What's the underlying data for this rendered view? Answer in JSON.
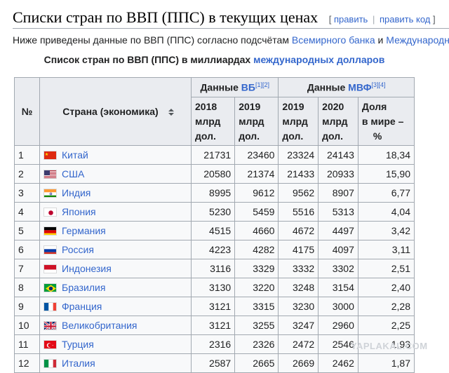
{
  "heading": {
    "title": "Списки стран по ВВП (ППС) в текущих ценах",
    "edit_bracket_open": "[",
    "edit_label": "править",
    "separator": "|",
    "edit_code_label": "править код",
    "edit_bracket_close": "]"
  },
  "intro": {
    "text_before": "Ниже приведены данные по ВВП (ППС) согласно подсчётам ",
    "link_world_bank": "Всемирного банка",
    "text_and": " и ",
    "link_imf": "Международного"
  },
  "caption": {
    "text": "Список стран по ВВП (ППС) в миллиардах ",
    "link": "международных долларов"
  },
  "table": {
    "header": {
      "number": "№",
      "country": "Страна (экономика)",
      "wb_group_prefix": "Данные ",
      "wb_group_link": "ВБ",
      "wb_refs": "[1][2]",
      "imf_group_prefix": "Данные ",
      "imf_group_link": "МВФ",
      "imf_refs": "[3][4]",
      "columns": [
        {
          "year": "2018",
          "unit1": "млрд",
          "unit2": "дол."
        },
        {
          "year": "2019",
          "unit1": "млрд",
          "unit2": "дол."
        },
        {
          "year": "2019",
          "unit1": "млрд",
          "unit2": "дол."
        },
        {
          "year": "2020",
          "unit1": "млрд",
          "unit2": "дол."
        }
      ],
      "share": {
        "line1": "Доля",
        "line2": "в мире –",
        "line3": "%"
      }
    },
    "rows": [
      {
        "rank": "1",
        "country": "Китай",
        "flag": "flag-china-icon",
        "wb2018": "21731",
        "wb2019": "23460",
        "imf2019": "23324",
        "imf2020": "24143",
        "share": "18,34"
      },
      {
        "rank": "2",
        "country": "США",
        "flag": "flag-usa-icon",
        "wb2018": "20580",
        "wb2019": "21374",
        "imf2019": "21433",
        "imf2020": "20933",
        "share": "15,90"
      },
      {
        "rank": "3",
        "country": "Индия",
        "flag": "flag-india-icon",
        "wb2018": "8995",
        "wb2019": "9612",
        "imf2019": "9562",
        "imf2020": "8907",
        "share": "6,77"
      },
      {
        "rank": "4",
        "country": "Япония",
        "flag": "flag-japan-icon",
        "wb2018": "5230",
        "wb2019": "5459",
        "imf2019": "5516",
        "imf2020": "5313",
        "share": "4,04"
      },
      {
        "rank": "5",
        "country": "Германия",
        "flag": "flag-germany-icon",
        "wb2018": "4515",
        "wb2019": "4660",
        "imf2019": "4672",
        "imf2020": "4497",
        "share": "3,42"
      },
      {
        "rank": "6",
        "country": "Россия",
        "flag": "flag-russia-icon",
        "wb2018": "4223",
        "wb2019": "4282",
        "imf2019": "4175",
        "imf2020": "4097",
        "share": "3,11"
      },
      {
        "rank": "7",
        "country": "Индонезия",
        "flag": "flag-indonesia-icon",
        "wb2018": "3116",
        "wb2019": "3329",
        "imf2019": "3332",
        "imf2020": "3302",
        "share": "2,51"
      },
      {
        "rank": "8",
        "country": "Бразилия",
        "flag": "flag-brazil-icon",
        "wb2018": "3130",
        "wb2019": "3220",
        "imf2019": "3248",
        "imf2020": "3154",
        "share": "2,40"
      },
      {
        "rank": "9",
        "country": "Франция",
        "flag": "flag-france-icon",
        "wb2018": "3121",
        "wb2019": "3315",
        "imf2019": "3230",
        "imf2020": "3000",
        "share": "2,28"
      },
      {
        "rank": "10",
        "country": "Великобритания",
        "flag": "flag-uk-icon",
        "wb2018": "3121",
        "wb2019": "3255",
        "imf2019": "3247",
        "imf2020": "2960",
        "share": "2,25"
      },
      {
        "rank": "11",
        "country": "Турция",
        "flag": "flag-turkey-icon",
        "wb2018": "2316",
        "wb2019": "2326",
        "imf2019": "2472",
        "imf2020": "2546",
        "share": "1,93"
      },
      {
        "rank": "12",
        "country": "Италия",
        "flag": "flag-italy-icon",
        "wb2018": "2587",
        "wb2019": "2665",
        "imf2019": "2669",
        "imf2020": "2462",
        "share": "1,87"
      }
    ]
  },
  "watermark": "YAPLAKAL.COM",
  "colors": {
    "link": "#3366cc",
    "header_bg": "#eaecf0",
    "cell_bg": "#f8f9fa",
    "border": "#a2a9b1"
  }
}
